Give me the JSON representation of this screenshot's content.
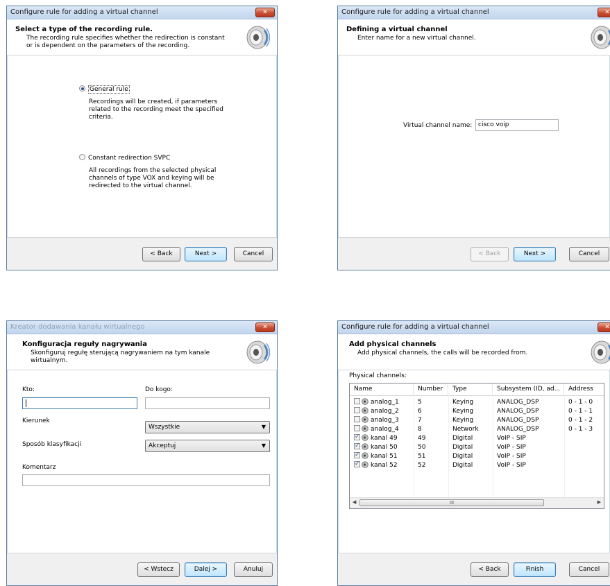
{
  "close_glyph": "✕",
  "speaker_icon": "speaker-icon",
  "dialog1": {
    "title": "Configure rule for adding a virtual channel",
    "header_title": "Select a type of the recording rule.",
    "header_sub": "The recording rule specifies whether the redirection is constant or is dependent on the parameters of the recording.",
    "option1_label": "General rule",
    "option1_desc": "Recordings will be created, if parameters related to the recording meet the specified criteria.",
    "option1_selected": true,
    "option2_label": "Constant redirection SVPC",
    "option2_desc": "All recordings from the selected physical channels of type VOX and keying will be redirected to the virtual channel.",
    "option2_selected": false,
    "back": "< Back",
    "next": "Next >",
    "cancel": "Cancel"
  },
  "dialog2": {
    "title": "Configure rule for adding a virtual channel",
    "header_title": "Defining a virtual channel",
    "header_sub": "Enter name for a new virtual channel.",
    "name_label": "Virtual channel name:",
    "name_value": "cisco voip",
    "back": "< Back",
    "next": "Next >",
    "cancel": "Cancel"
  },
  "dialog3": {
    "title": "Kreator dodawania kanału wirtualnego",
    "header_title": "Konfiguracja reguły nagrywania",
    "header_sub": "Skonfiguruj regułę sterującą nagrywaniem na tym kanale wirtualnym.",
    "kto_label": "Kto:",
    "kto_value": "",
    "do_kogo_label": "Do kogo:",
    "do_kogo_value": "",
    "kierunek_label": "Kierunek",
    "kierunek_value": "Wszystkie",
    "sposob_label": "Sposób klasyfikacji",
    "sposob_value": "Akceptuj",
    "komentarz_label": "Komentarz",
    "komentarz_value": "",
    "back": "< Wstecz",
    "next": "Dalej >",
    "cancel": "Anuluj"
  },
  "dialog4": {
    "title": "Configure rule for adding a virtual channel",
    "header_title": "Add physical channels",
    "header_sub": "Add physical channels, the calls will be recorded from.",
    "list_label": "Physical channels:",
    "columns": [
      "Name",
      "Number",
      "Type",
      "Subsystem (ID, ad...",
      "Address"
    ],
    "rows": [
      {
        "checked": false,
        "name": "analog_1",
        "number": "5",
        "type": "Keying",
        "subsystem": "ANALOG_DSP",
        "address": "0 - 1 - 0"
      },
      {
        "checked": false,
        "name": "analog_2",
        "number": "6",
        "type": "Keying",
        "subsystem": "ANALOG_DSP",
        "address": "0 - 1 - 1"
      },
      {
        "checked": false,
        "name": "analog_3",
        "number": "7",
        "type": "Keying",
        "subsystem": "ANALOG_DSP",
        "address": "0 - 1 - 2"
      },
      {
        "checked": false,
        "name": "analog_4",
        "number": "8",
        "type": "Network",
        "subsystem": "ANALOG_DSP",
        "address": "0 - 1 - 3"
      },
      {
        "checked": true,
        "name": "kanal 49",
        "number": "49",
        "type": "Digital",
        "subsystem": "VoIP - SIP",
        "address": ""
      },
      {
        "checked": true,
        "name": "kanal 50",
        "number": "50",
        "type": "Digital",
        "subsystem": "VoIP - SIP",
        "address": ""
      },
      {
        "checked": true,
        "name": "kanal 51",
        "number": "51",
        "type": "Digital",
        "subsystem": "VoIP - SIP",
        "address": ""
      },
      {
        "checked": true,
        "name": "kanal 52",
        "number": "52",
        "type": "Digital",
        "subsystem": "VoIP - SIP",
        "address": ""
      }
    ],
    "scroll_grip": "III",
    "back": "< Back",
    "finish": "Finish",
    "cancel": "Cancel"
  }
}
